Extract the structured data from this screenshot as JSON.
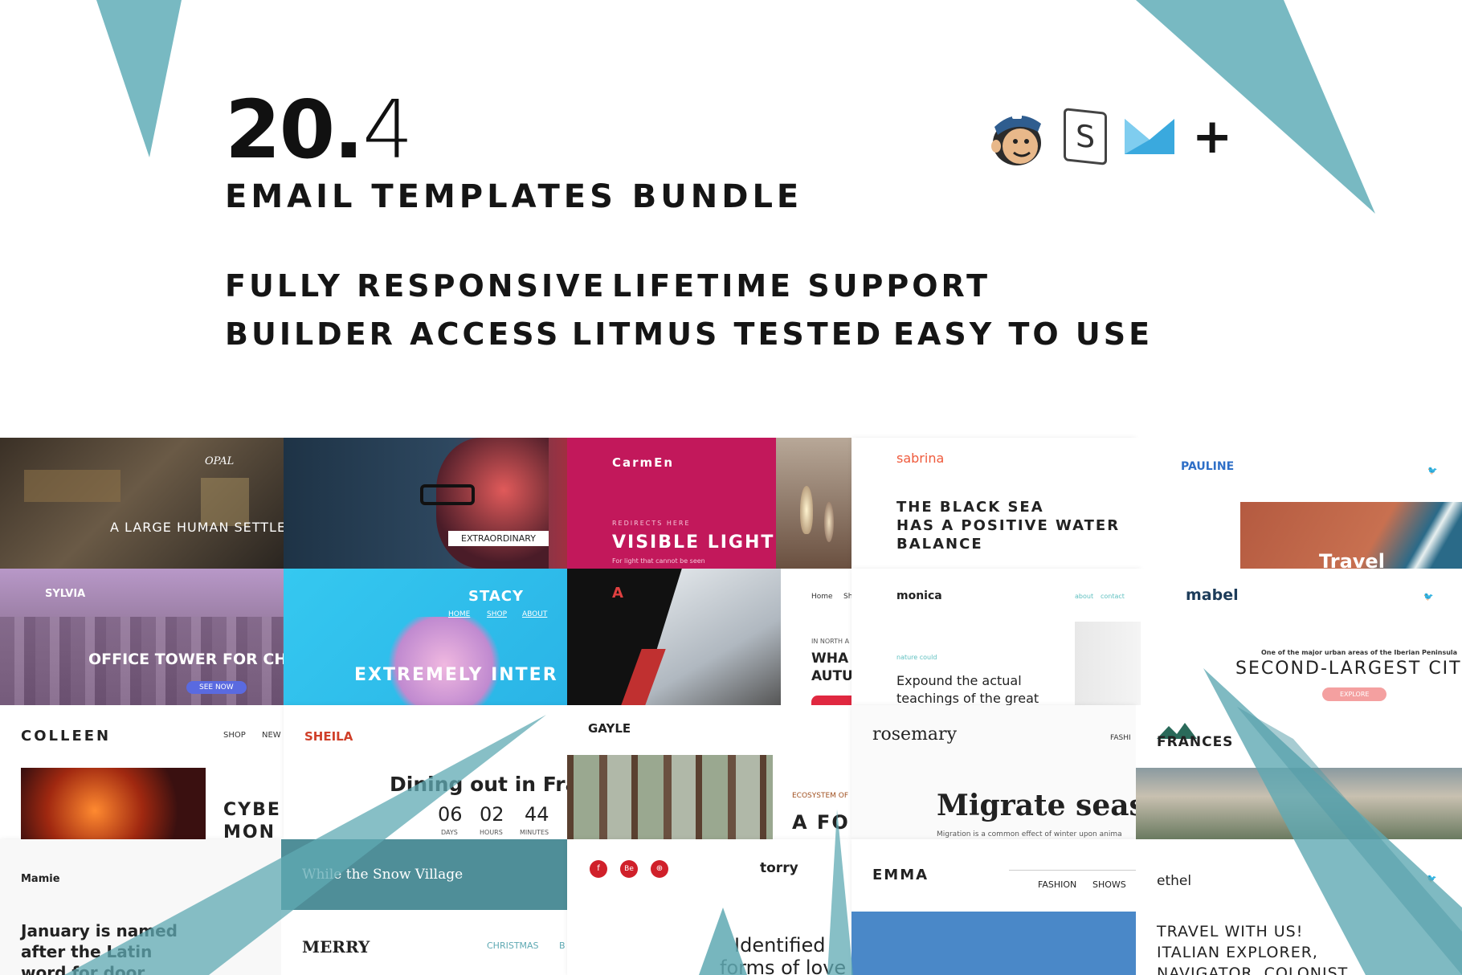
{
  "header": {
    "version_major": "20.",
    "version_minor": "4",
    "title": "EMAIL TEMPLATES BUNDLE",
    "features_row1": [
      "FULLY RESPONSIVE",
      "LIFETIME SUPPORT"
    ],
    "features_row2": [
      "BUILDER ACCESS",
      "LITMUS TESTED",
      "EASY TO USE"
    ],
    "logos": [
      "mailchimp-icon",
      "stampready-icon",
      "campaign-monitor-icon"
    ],
    "plus": "+",
    "stampready_letter": "S"
  },
  "colors": {
    "accent": "#5fa9b3",
    "dark": "#151515",
    "carmen": "#c2185b"
  },
  "tiles": {
    "opal": {
      "brand": "OPAL",
      "headline": "A LARGE HUMAN SETTLE"
    },
    "extraordinary": {
      "button": "EXTRAORDINARY"
    },
    "carmen": {
      "brand": "CarmEn",
      "kicker": "REDIRECTS HERE",
      "headline": "VISIBLE LIGHT",
      "sub": "For light that cannot be seen"
    },
    "sabrina": {
      "brand": "sabrina",
      "headline1": "THE BLACK SEA",
      "headline2": "HAS A POSITIVE WATER",
      "headline3": "BALANCE"
    },
    "pauline": {
      "brand": "PAULINE",
      "word": "Travel"
    },
    "sylvia": {
      "brand": "SYLVIA",
      "headline": "OFFICE TOWER FOR CH",
      "button": "SEE NOW"
    },
    "stacy": {
      "brand": "STACY",
      "nav": [
        "HOME",
        "SHOP",
        "ABOUT"
      ],
      "headline": "EXTREMELY INTER"
    },
    "dark": {
      "nav1": "Home",
      "nav2": "Sh",
      "kicker": "IN NORTH A",
      "h1": "WHA",
      "h2": "AUTU"
    },
    "monica": {
      "brand": "monica",
      "nav": [
        "about",
        "contact"
      ],
      "kicker": "nature could",
      "text1": "Expound the actual",
      "text2": "teachings of the great"
    },
    "mabel": {
      "brand": "mabel",
      "kicker": "One of the major urban areas of the Iberian Peninsula",
      "headline": "SECOND-LARGEST CIT",
      "button": "EXPLORE"
    },
    "colleen": {
      "brand": "COLLEEN",
      "nav": [
        "SHOP",
        "NEW"
      ],
      "h1": "CYBE",
      "h2": "MON"
    },
    "sheila": {
      "brand": "SHEILA",
      "headline": "Dining out in Fra",
      "count": [
        "06",
        "02",
        "44"
      ],
      "labels": [
        "DAYS",
        "HOURS",
        "MINUTES"
      ]
    },
    "gayle": {
      "brand": "GAYLE",
      "kicker": "ECOSYSTEM OF",
      "headline": "A FO"
    },
    "rosemary": {
      "brand": "rosemary",
      "nav": "FASHI",
      "headline": "Migrate seaso",
      "sub": "Migration is a common effect of winter upon anima"
    },
    "frances": {
      "brand": "FRANCES"
    },
    "mamie": {
      "brand": "Mamie",
      "text1": "January is named",
      "text2": "after the Latin",
      "text3": "word for door"
    },
    "snow": {
      "headline": "While the Snow Village"
    },
    "merry": {
      "brand": "MERRY",
      "nav": "CHRISTMAS",
      "nav2": "B"
    },
    "torry": {
      "brand": "torry",
      "social": [
        "f",
        "Be",
        "⊕"
      ],
      "h1": "Identified",
      "h2": "forms of love"
    },
    "emma": {
      "brand": "EMMA",
      "nav": [
        "FASHION",
        "SHOWS"
      ]
    },
    "ethel": {
      "brand": "ethel",
      "t1": "TRAVEL WITH US!",
      "t2": "ITALIAN EXPLORER,",
      "t3": "NAVIGATOR, COLONIST"
    }
  }
}
